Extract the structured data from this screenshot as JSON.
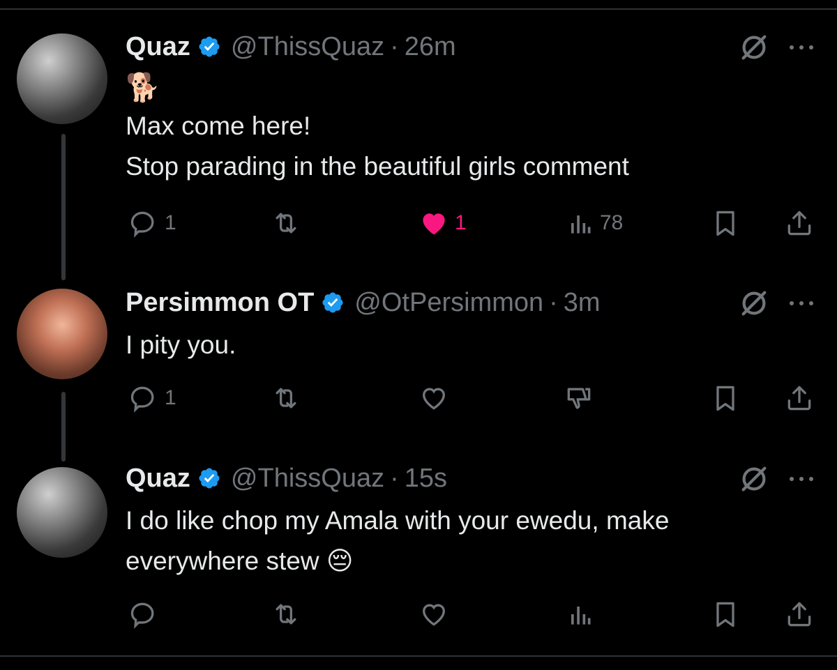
{
  "tweets": [
    {
      "name": "Quaz",
      "handle": "@ThissQuaz",
      "separator": "·",
      "time": "26m",
      "emoji": "🐕",
      "lines": [
        "Max come here!",
        "Stop parading in the beautiful girls comment"
      ],
      "replies": "1",
      "likes": "1",
      "liked": true,
      "views": "78"
    },
    {
      "name": "Persimmon OT",
      "handle": "@OtPersimmon",
      "separator": "·",
      "time": "3m",
      "lines": [
        "I pity you."
      ],
      "replies": "1"
    },
    {
      "name": "Quaz",
      "handle": "@ThissQuaz",
      "separator": "·",
      "time": "15s",
      "lines": [
        "I do like chop my Amala with your ewedu, make",
        "everywhere stew 😔"
      ]
    }
  ],
  "icons": {
    "verified": "verified-badge-icon",
    "grok": "grok-icon",
    "more": "more-icon",
    "reply": "reply-icon",
    "repost": "repost-icon",
    "like": "heart-icon",
    "views": "views-icon",
    "downvote": "downvote-icon",
    "bookmark": "bookmark-icon",
    "share": "share-icon"
  },
  "colors": {
    "background": "#000000",
    "text": "#e7e9ea",
    "muted": "#71767b",
    "verified": "#1d9bf0",
    "like": "#f91880"
  }
}
